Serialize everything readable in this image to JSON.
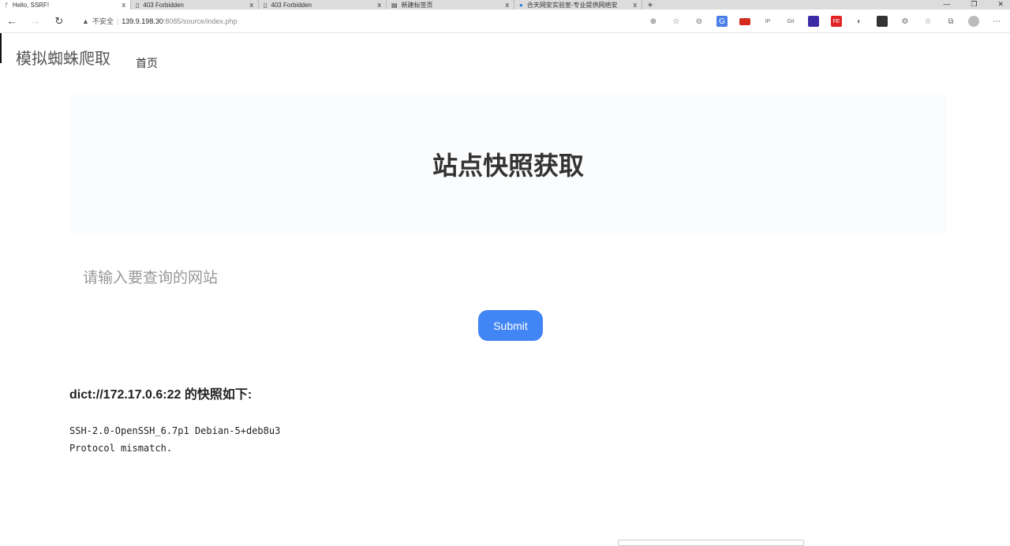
{
  "browser": {
    "tabs": [
      {
        "title": "Hello, SSRF!",
        "active": true
      },
      {
        "title": "403 Forbidden"
      },
      {
        "title": "403 Forbidden"
      },
      {
        "title": "新建标签页"
      },
      {
        "title": "合天网安实验室-专业提供网络安"
      }
    ],
    "close_glyph": "x",
    "new_tab": "+",
    "security_label": "不安全",
    "url_host": "139.9.198.30",
    "url_rest": ":8085/source/index.php",
    "ext_ip": "IP",
    "ext_git": "Git"
  },
  "site": {
    "brand": "模拟蜘蛛爬取",
    "nav_home": "首页",
    "heading": "站点快照获取",
    "input_placeholder": "请输入要查询的网站",
    "submit_label": "Submit",
    "result_title": "dict://172.17.0.6:22 的快照如下:",
    "result_lines": [
      "SSH-2.0-OpenSSH_6.7p1 Debian-5+deb8u3",
      "Protocol mismatch."
    ]
  },
  "colors": {
    "accent": "#4285f4"
  }
}
